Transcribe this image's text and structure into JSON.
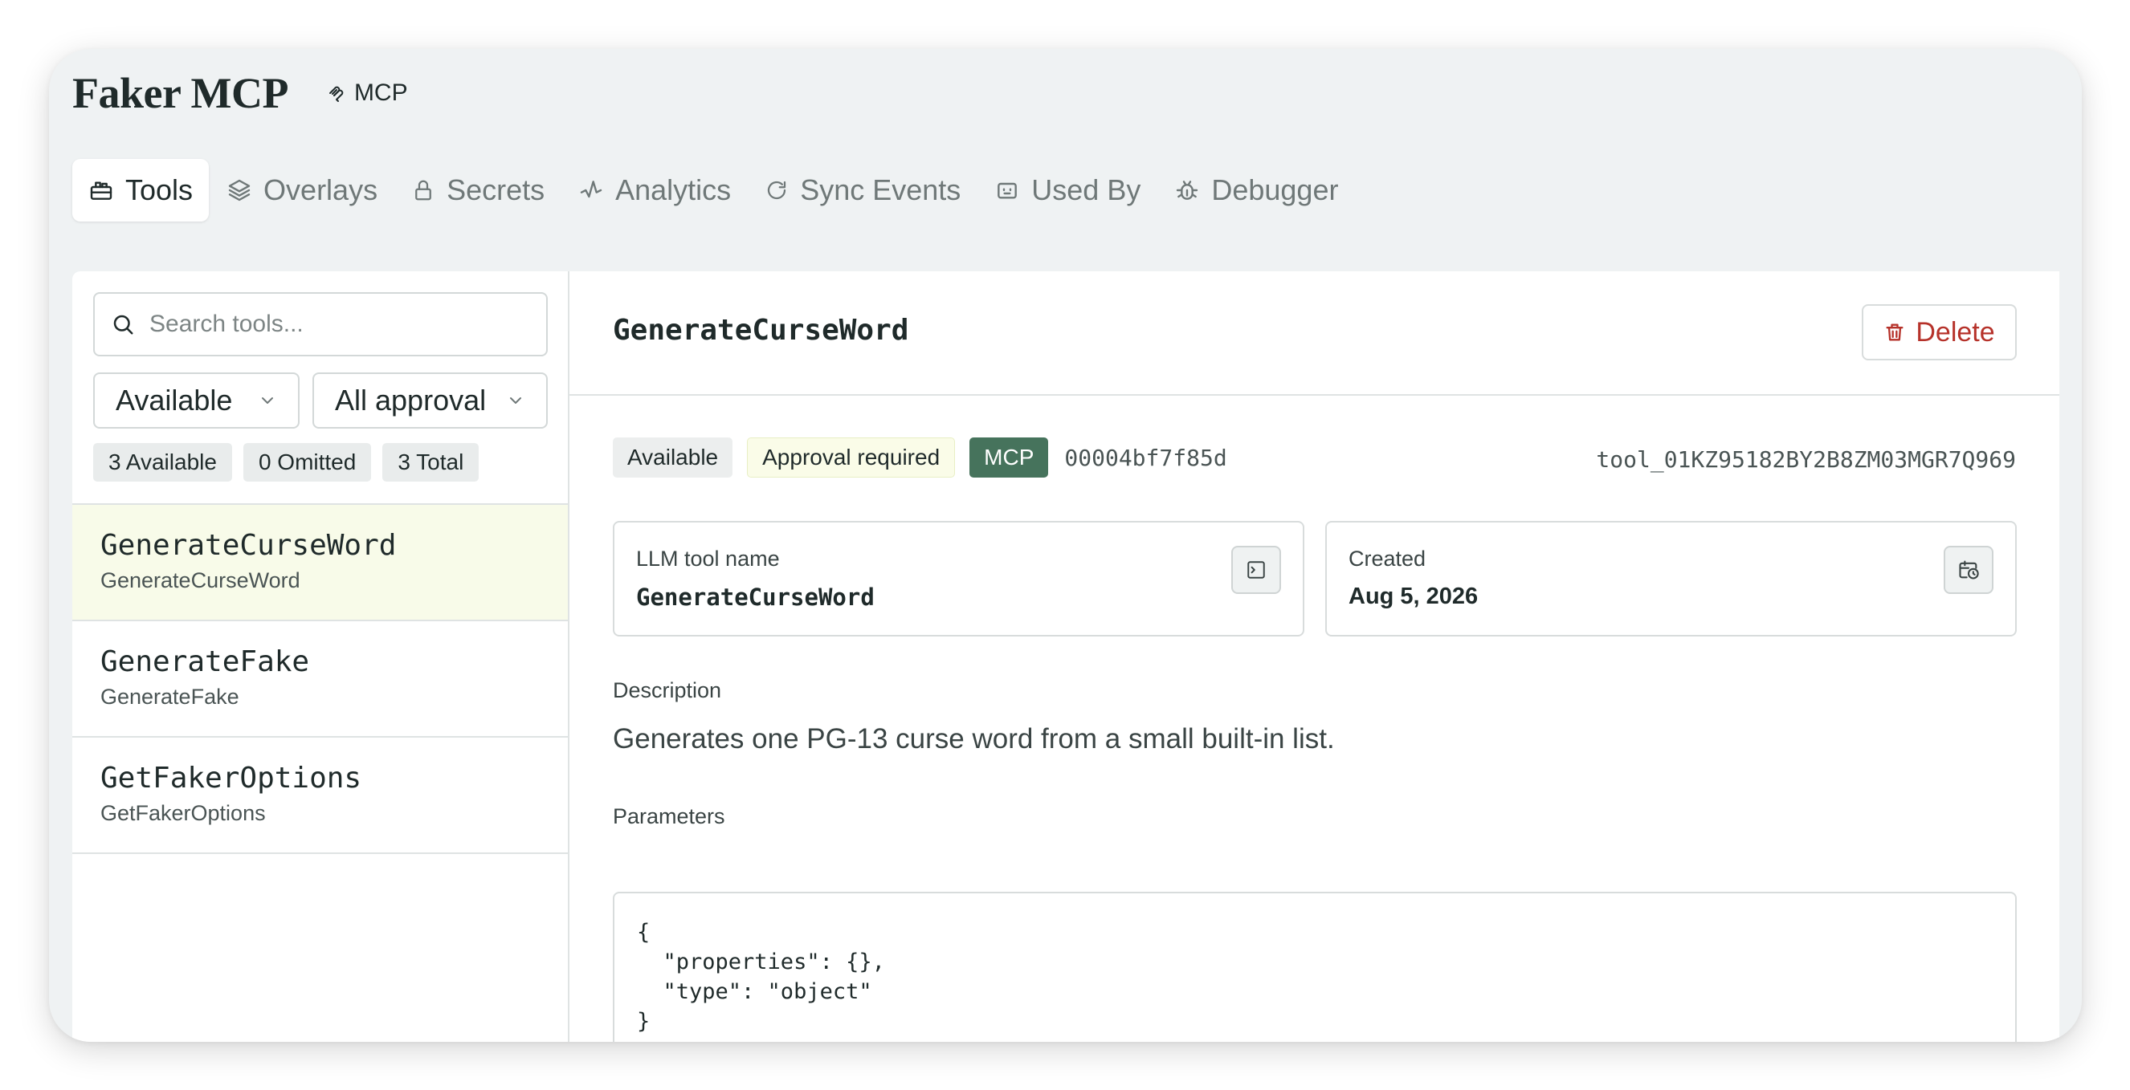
{
  "app": {
    "title": "Faker MCP",
    "tag": "MCP"
  },
  "tabs": [
    {
      "label": "Tools",
      "icon": "toolbox-icon",
      "active": true
    },
    {
      "label": "Overlays",
      "icon": "layers-icon"
    },
    {
      "label": "Secrets",
      "icon": "lock-icon"
    },
    {
      "label": "Analytics",
      "icon": "analytics-icon"
    },
    {
      "label": "Sync Events",
      "icon": "refresh-icon"
    },
    {
      "label": "Used By",
      "icon": "bot-icon"
    },
    {
      "label": "Debugger",
      "icon": "bug-icon"
    }
  ],
  "sidebar": {
    "search_placeholder": "Search tools...",
    "availability_filter": "Available",
    "approval_filter": "All approval",
    "counts": [
      "3 Available",
      "0 Omitted",
      "3 Total"
    ],
    "tools": [
      {
        "name": "GenerateCurseWord",
        "subtitle": "GenerateCurseWord",
        "selected": true
      },
      {
        "name": "GenerateFake",
        "subtitle": "GenerateFake"
      },
      {
        "name": "GetFakerOptions",
        "subtitle": "GetFakerOptions"
      }
    ]
  },
  "detail": {
    "title": "GenerateCurseWord",
    "delete_label": "Delete",
    "badges": {
      "status": "Available",
      "approval": "Approval required",
      "source": "MCP"
    },
    "hash": "00004bf7f85d",
    "tool_id": "tool_01KZ95182BY2B8ZM03MGR7Q969",
    "llm_name_label": "LLM tool name",
    "llm_name_value": "GenerateCurseWord",
    "created_label": "Created",
    "created_value": "Aug 5, 2026",
    "description_label": "Description",
    "description": "Generates one PG-13 curse word from a small built-in list.",
    "parameters_label": "Parameters",
    "parameters_json": "{\n  \"properties\": {},\n  \"type\": \"object\"\n}"
  },
  "colors": {
    "mcp_badge": "#46735c",
    "delete": "#b6322a",
    "selected_row": "#f8fbe9",
    "approval_badge": "#fafce8"
  }
}
